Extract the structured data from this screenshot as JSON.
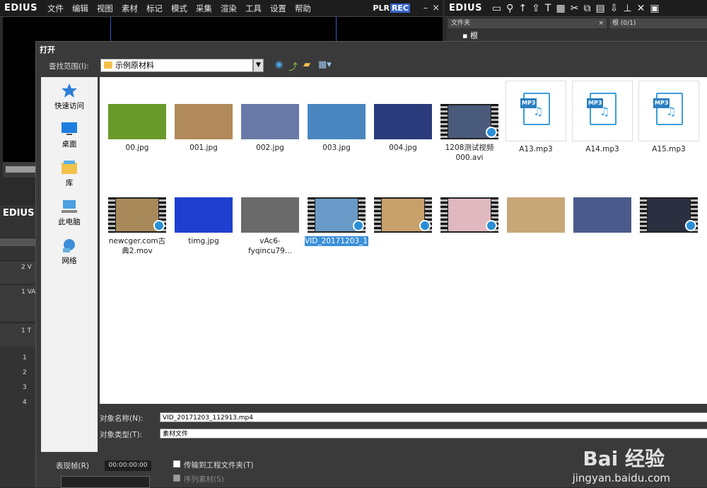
{
  "app": {
    "brand": "EDIUS",
    "plr": "PLR",
    "rec": "REC"
  },
  "menu": [
    "文件",
    "编辑",
    "视图",
    "素材",
    "标记",
    "模式",
    "采集",
    "渲染",
    "工具",
    "设置",
    "帮助"
  ],
  "bin": {
    "brand": "EDIUS",
    "folder_header": "文件夹",
    "root": "根",
    "root_count": "根 (0/1)"
  },
  "timeline": {
    "brand": "EDIUS",
    "rows": [
      "2 V",
      "1 VA",
      "1 T",
      "1",
      "2",
      "3",
      "4"
    ]
  },
  "dialog": {
    "title": "打开",
    "lookin_label": "查找范围(I):",
    "lookin_value": "示例原材料",
    "places": [
      "快速访问",
      "桌面",
      "库",
      "此电脑",
      "网络"
    ],
    "files_row1": [
      {
        "name": "00.jpg",
        "kind": "image",
        "color": "#6a9a2a"
      },
      {
        "name": "001.jpg",
        "kind": "image",
        "color": "#b08a5a"
      },
      {
        "name": "002.jpg",
        "kind": "image",
        "color": "#6a7aa8"
      },
      {
        "name": "003.jpg",
        "kind": "image",
        "color": "#4a86c0"
      },
      {
        "name": "004.jpg",
        "kind": "image",
        "color": "#2a3a7a"
      },
      {
        "name": "1208测试视频000.avi",
        "kind": "video",
        "color": "#4a5a7a"
      },
      {
        "name": "A13.mp3",
        "kind": "mp3"
      },
      {
        "name": "A14.mp3",
        "kind": "mp3"
      },
      {
        "name": "A15.mp3",
        "kind": "mp3"
      }
    ],
    "files_row2": [
      {
        "name": "newcger.com古典2.mov",
        "kind": "video",
        "color": "#a88a5a"
      },
      {
        "name": "timg.jpg",
        "kind": "image",
        "color": "#1f3fd0"
      },
      {
        "name": "vAc6-fyqincu79...",
        "kind": "image",
        "color": "#6a6a6a"
      },
      {
        "name": "VID_20171203_112913.mp4",
        "kind": "video",
        "color": "#6a9ac8",
        "selected": true
      },
      {
        "name": "",
        "kind": "video",
        "color": "#c8a06a"
      },
      {
        "name": "",
        "kind": "video",
        "color": "#e0b8c0"
      },
      {
        "name": "",
        "kind": "image",
        "color": "#c8a878"
      },
      {
        "name": "",
        "kind": "image",
        "color": "#4a5a8a"
      },
      {
        "name": "",
        "kind": "video",
        "color": "#2a3040"
      }
    ],
    "mp3_tag": "MP3",
    "name_label": "对象名称(N):",
    "name_value": "VID_20171203_112913.mp4",
    "type_label": "对象类型(T):",
    "type_value": "素材文件",
    "frame_label": "表现帧(R)",
    "timecode": "00:00:00:00",
    "transfer_label": "传输到工程文件夹(T)",
    "sequence_label": "序列素材(S)"
  },
  "watermark": {
    "brand": "Bai 经验",
    "url": "jingyan.baidu.com"
  }
}
